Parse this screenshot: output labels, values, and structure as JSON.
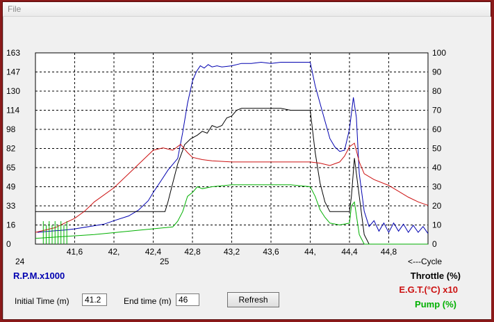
{
  "menu": {
    "file": "File"
  },
  "chart_data": {
    "type": "line",
    "x_tick_labels": [
      "41,6",
      "42,",
      "42,4",
      "42,8",
      "43,2",
      "43,6",
      "44,",
      "44,4",
      "44,8"
    ],
    "x_tick_values": [
      41.6,
      42.0,
      42.4,
      42.8,
      43.2,
      43.6,
      44.0,
      44.4,
      44.8
    ],
    "x_range": [
      41.2,
      45.2
    ],
    "left_axis": {
      "ticks": [
        "163",
        "147",
        "130",
        "114",
        "98",
        "82",
        "65",
        "49",
        "33",
        "16",
        "0"
      ],
      "range": [
        0,
        163
      ]
    },
    "right_axis": {
      "ticks": [
        "100",
        "90",
        "80",
        "70",
        "60",
        "50",
        "40",
        "30",
        "20",
        "10",
        "0"
      ],
      "range": [
        0,
        100
      ]
    },
    "cycle_labels": {
      "start": "24",
      "mid": "25",
      "arrow": "<---Cycle"
    },
    "grid": true,
    "colors": {
      "rpm": "#0000b0",
      "throttle": "#000000",
      "egt": "#cc1010",
      "pump": "#00b000"
    },
    "series": [
      {
        "name": "R.P.M.x1000",
        "axis": "left",
        "points": [
          [
            41.22,
            10
          ],
          [
            41.35,
            11
          ],
          [
            41.5,
            12
          ],
          [
            41.6,
            13
          ],
          [
            41.75,
            15
          ],
          [
            41.9,
            17
          ],
          [
            42.0,
            20
          ],
          [
            42.15,
            24
          ],
          [
            42.25,
            29
          ],
          [
            42.35,
            37
          ],
          [
            42.4,
            44
          ],
          [
            42.48,
            54
          ],
          [
            42.55,
            63
          ],
          [
            42.6,
            68
          ],
          [
            42.65,
            73
          ],
          [
            42.7,
            95
          ],
          [
            42.75,
            120
          ],
          [
            42.8,
            139
          ],
          [
            42.84,
            147
          ],
          [
            42.88,
            152
          ],
          [
            42.92,
            150
          ],
          [
            42.96,
            153
          ],
          [
            43.0,
            151
          ],
          [
            43.05,
            152
          ],
          [
            43.1,
            151
          ],
          [
            43.2,
            152
          ],
          [
            43.3,
            154
          ],
          [
            43.4,
            154
          ],
          [
            43.5,
            155
          ],
          [
            43.6,
            154
          ],
          [
            43.7,
            155
          ],
          [
            43.8,
            155
          ],
          [
            43.9,
            155
          ],
          [
            44.0,
            155
          ],
          [
            44.05,
            135
          ],
          [
            44.1,
            120
          ],
          [
            44.15,
            105
          ],
          [
            44.2,
            90
          ],
          [
            44.25,
            83
          ],
          [
            44.3,
            79
          ],
          [
            44.35,
            80
          ],
          [
            44.4,
            98
          ],
          [
            44.44,
            125
          ],
          [
            44.47,
            108
          ],
          [
            44.5,
            60
          ],
          [
            44.55,
            28
          ],
          [
            44.6,
            15
          ],
          [
            44.65,
            20
          ],
          [
            44.7,
            11
          ],
          [
            44.75,
            18
          ],
          [
            44.8,
            10
          ],
          [
            44.85,
            18
          ],
          [
            44.9,
            11
          ],
          [
            44.95,
            17
          ],
          [
            45.0,
            10
          ],
          [
            45.05,
            16
          ],
          [
            45.1,
            10
          ],
          [
            45.15,
            15
          ],
          [
            45.2,
            9
          ]
        ]
      },
      {
        "name": "Throttle (%)",
        "axis": "right",
        "points": [
          [
            41.2,
            17
          ],
          [
            41.3,
            17
          ],
          [
            41.5,
            17
          ],
          [
            41.8,
            17
          ],
          [
            42.0,
            17
          ],
          [
            42.2,
            17
          ],
          [
            42.4,
            17
          ],
          [
            42.52,
            17
          ],
          [
            42.55,
            22
          ],
          [
            42.6,
            32
          ],
          [
            42.65,
            42
          ],
          [
            42.7,
            49
          ],
          [
            42.72,
            52
          ],
          [
            42.78,
            55
          ],
          [
            42.85,
            57
          ],
          [
            42.9,
            59
          ],
          [
            42.95,
            58
          ],
          [
            43.0,
            62
          ],
          [
            43.05,
            61
          ],
          [
            43.1,
            62
          ],
          [
            43.15,
            66
          ],
          [
            43.2,
            67
          ],
          [
            43.25,
            70
          ],
          [
            43.3,
            71
          ],
          [
            43.4,
            71
          ],
          [
            43.5,
            71
          ],
          [
            43.6,
            71
          ],
          [
            43.7,
            71
          ],
          [
            43.8,
            70
          ],
          [
            43.9,
            70
          ],
          [
            44.0,
            70
          ],
          [
            44.05,
            48
          ],
          [
            44.1,
            32
          ],
          [
            44.15,
            22
          ],
          [
            44.2,
            17
          ],
          [
            44.3,
            17
          ],
          [
            44.4,
            17
          ],
          [
            44.42,
            25
          ],
          [
            44.45,
            45
          ],
          [
            44.5,
            25
          ],
          [
            44.55,
            5
          ],
          [
            44.6,
            0
          ],
          [
            45.2,
            0
          ]
        ]
      },
      {
        "name": "E.G.T.(°C) x10",
        "axis": "left",
        "points": [
          [
            41.2,
            10
          ],
          [
            41.4,
            14
          ],
          [
            41.6,
            22
          ],
          [
            41.7,
            28
          ],
          [
            41.8,
            36
          ],
          [
            42.0,
            48
          ],
          [
            42.2,
            64
          ],
          [
            42.4,
            80
          ],
          [
            42.5,
            82
          ],
          [
            42.6,
            80
          ],
          [
            42.68,
            85
          ],
          [
            42.75,
            78
          ],
          [
            42.8,
            74
          ],
          [
            42.9,
            72
          ],
          [
            43.0,
            71
          ],
          [
            43.2,
            70
          ],
          [
            43.5,
            70
          ],
          [
            43.8,
            70
          ],
          [
            44.0,
            70
          ],
          [
            44.1,
            69
          ],
          [
            44.2,
            67
          ],
          [
            44.3,
            70
          ],
          [
            44.35,
            75
          ],
          [
            44.4,
            83
          ],
          [
            44.45,
            86
          ],
          [
            44.5,
            70
          ],
          [
            44.55,
            60
          ],
          [
            44.65,
            55
          ],
          [
            44.8,
            50
          ],
          [
            44.9,
            45
          ],
          [
            45.0,
            40
          ],
          [
            45.1,
            36
          ],
          [
            45.2,
            33
          ]
        ]
      },
      {
        "name": "Pump (%)",
        "axis": "right",
        "points": [
          [
            41.2,
            3
          ],
          [
            41.5,
            4
          ],
          [
            41.8,
            5
          ],
          [
            42.0,
            6
          ],
          [
            42.2,
            7
          ],
          [
            42.4,
            8
          ],
          [
            42.6,
            9
          ],
          [
            42.65,
            12
          ],
          [
            42.7,
            17
          ],
          [
            42.75,
            25
          ],
          [
            42.8,
            27
          ],
          [
            42.85,
            30
          ],
          [
            42.9,
            29
          ],
          [
            43.0,
            30
          ],
          [
            43.2,
            31
          ],
          [
            43.5,
            31
          ],
          [
            43.8,
            31
          ],
          [
            44.0,
            30
          ],
          [
            44.05,
            25
          ],
          [
            44.1,
            18
          ],
          [
            44.15,
            14
          ],
          [
            44.2,
            11
          ],
          [
            44.3,
            10
          ],
          [
            44.4,
            11
          ],
          [
            44.42,
            20
          ],
          [
            44.45,
            22
          ],
          [
            44.5,
            5
          ],
          [
            44.55,
            0
          ],
          [
            45.2,
            0
          ]
        ]
      }
    ]
  },
  "legend": {
    "rpm": "R.P.M.x1000",
    "throttle": "Throttle (%)",
    "egt": "E.G.T.(°C) x10",
    "pump": "Pump (%)"
  },
  "controls": {
    "initial_time_label": "Initial Time (m)",
    "initial_time_value": "41.2",
    "end_time_label": "End time (m)",
    "end_time_value": "46",
    "refresh_label": "Refresh"
  }
}
